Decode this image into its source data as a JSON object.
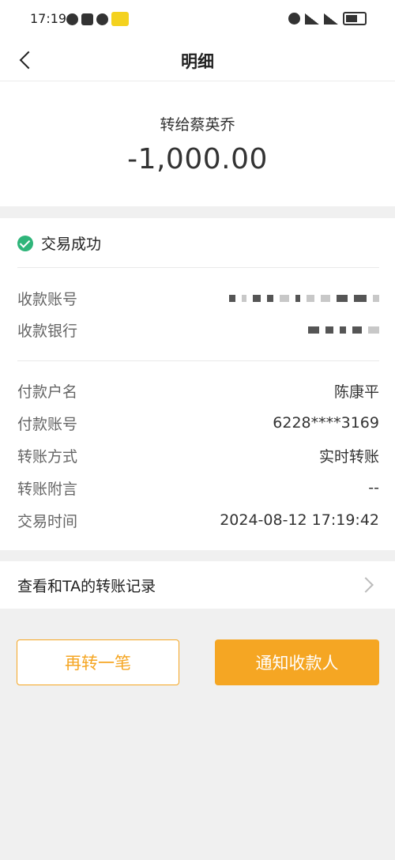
{
  "status_bar": {
    "time": "17:19",
    "icons_left": [
      "chat-icon",
      "gift-icon",
      "wechat-icon",
      "meituan-badge-icon"
    ],
    "icons_right": [
      "alarm-icon",
      "wifi-icon",
      "5g-signal-icon",
      "battery-icon"
    ]
  },
  "nav": {
    "title": "明细",
    "back_icon": "chevron-left-icon"
  },
  "summary": {
    "recipient": "转给蔡英乔",
    "amount": "-1,000.00"
  },
  "transaction": {
    "status": "交易成功",
    "status_color": "#2fb57a",
    "payee_rows": [
      {
        "label": "收款账号",
        "value": ""
      },
      {
        "label": "收款银行",
        "value": ""
      }
    ],
    "detail_rows": [
      {
        "label": "付款户名",
        "value": "陈康平"
      },
      {
        "label": "付款账号",
        "value": "6228****3169"
      },
      {
        "label": "转账方式",
        "value": "实时转账"
      },
      {
        "label": "转账附言",
        "value": "--"
      },
      {
        "label": "交易时间",
        "value": "2024-08-12 17:19:42"
      }
    ]
  },
  "record_link": {
    "label": "查看和TA的转账记录"
  },
  "actions": {
    "again_label": "再转一笔",
    "notify_label": "通知收款人",
    "accent_color": "#f5a623"
  }
}
